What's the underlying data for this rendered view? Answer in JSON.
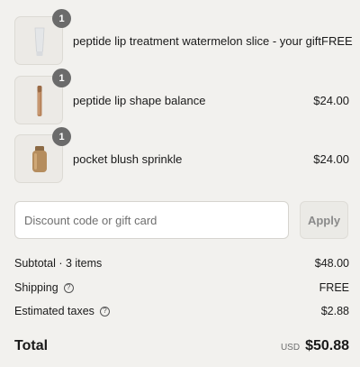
{
  "items": [
    {
      "name": "peptide lip treatment watermelon slice - your gift",
      "price": "FREE",
      "quantity": "1",
      "image": "lip-tube-product-image"
    },
    {
      "name": "peptide lip shape balance",
      "price": "$24.00",
      "quantity": "1",
      "image": "lip-pencil-product-image"
    },
    {
      "name": "pocket blush sprinkle",
      "price": "$24.00",
      "quantity": "1",
      "image": "blush-bottle-product-image"
    }
  ],
  "discount": {
    "placeholder": "Discount code or gift card",
    "apply_label": "Apply"
  },
  "summary": {
    "subtotal_label": "Subtotal · 3 items",
    "subtotal_value": "$48.00",
    "shipping_label": "Shipping",
    "shipping_value": "FREE",
    "taxes_label": "Estimated taxes",
    "taxes_value": "$2.88",
    "help_icon": "question-circle-icon"
  },
  "total": {
    "label": "Total",
    "currency": "USD",
    "amount": "$50.88"
  },
  "colors": {
    "background": "#f2f1ee",
    "badge": "#6b6b6b"
  }
}
